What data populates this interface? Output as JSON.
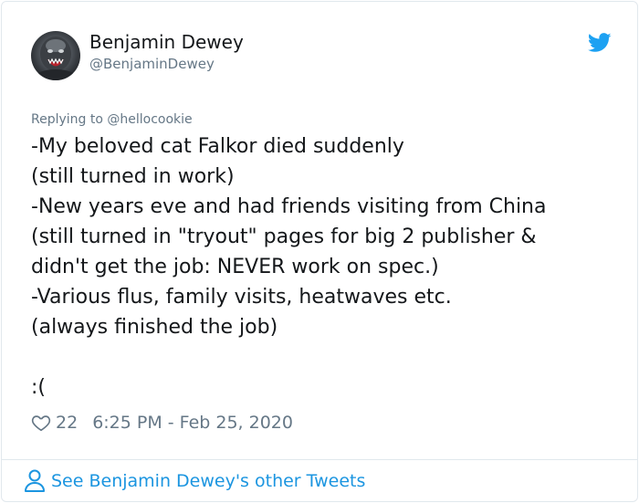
{
  "author": {
    "name": "Benjamin Dewey",
    "handle": "@BenjaminDewey"
  },
  "reply": {
    "text": "Replying to @hellocookie"
  },
  "tweet": {
    "lines": [
      "-My beloved cat Falkor died suddenly",
      "(still turned in work)",
      "-New years eve and had friends visiting from China",
      "(still turned in \"tryout\" pages for big 2 publisher &",
      "didn't get the job: NEVER work on spec.)",
      "-Various flus, family visits, heatwaves etc.",
      "(always finished the job)",
      "",
      ":("
    ]
  },
  "meta": {
    "likes": "22",
    "timestamp": "6:25 PM - Feb 25, 2020"
  },
  "footer": {
    "link_text": "See Benjamin Dewey's other Tweets"
  },
  "icons": {
    "bird": "twitter-bird-icon",
    "heart": "heart-icon",
    "person": "person-icon"
  },
  "colors": {
    "brand": "#1da1f2",
    "link": "#1b95e0",
    "secondary_text": "#657786"
  }
}
